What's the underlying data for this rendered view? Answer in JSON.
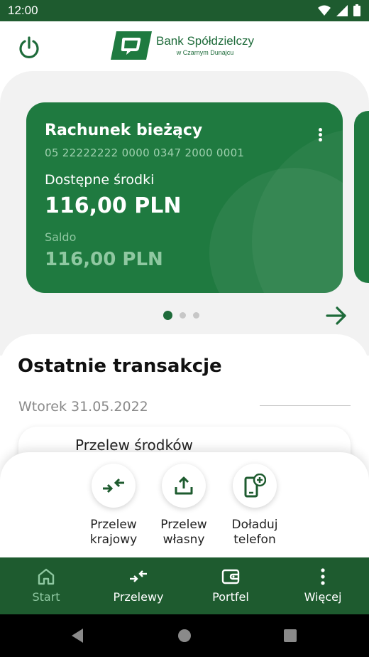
{
  "status_bar": {
    "time": "12:00"
  },
  "header": {
    "logo_name": "Bank Spółdzielczy",
    "logo_sub": "w Czarnym Dunajcu"
  },
  "account_card": {
    "title": "Rachunek bieżący",
    "number": "05 22222222 0000 0347 2000 0001",
    "available_label": "Dostępne środki",
    "available_value": "116,00 PLN",
    "saldo_label": "Saldo",
    "saldo_value": "116,00 PLN"
  },
  "carousel": {
    "pages": 3,
    "active_page": 1
  },
  "transactions": {
    "title": "Ostatnie transakcje",
    "date": "Wtorek 31.05.2022",
    "items": [
      {
        "label": "Przelew środków"
      }
    ]
  },
  "quick_actions": [
    {
      "line1": "Przelew",
      "line2": "krajowy",
      "icon": "transfer-arrows-icon"
    },
    {
      "line1": "Przelew",
      "line2": "własny",
      "icon": "upload-icon"
    },
    {
      "line1": "Doładuj",
      "line2": "telefon",
      "icon": "phone-topup-icon"
    }
  ],
  "bottom_nav": [
    {
      "label": "Start",
      "icon": "home-icon",
      "active": true
    },
    {
      "label": "Przelewy",
      "icon": "transfer-arrows-icon",
      "active": false
    },
    {
      "label": "Portfel",
      "icon": "wallet-icon",
      "active": false
    },
    {
      "label": "Więcej",
      "icon": "more-vertical-icon",
      "active": false
    }
  ],
  "colors": {
    "brand_dark": "#1e5b2f",
    "card_green": "#1f7a40",
    "accent_light": "#8fc8a1"
  }
}
